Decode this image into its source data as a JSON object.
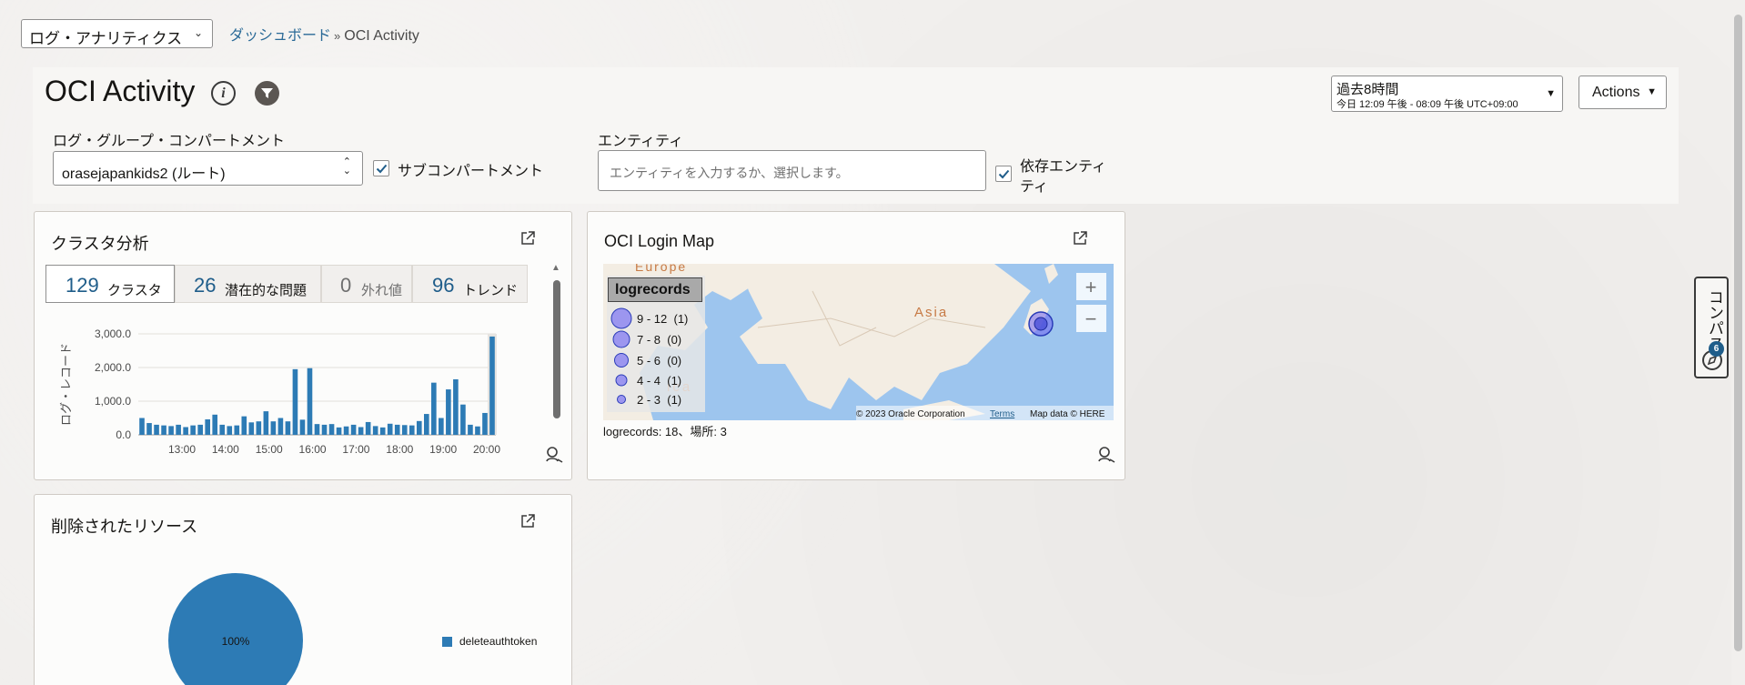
{
  "app_selector": {
    "value": "ログ・アナリティクス"
  },
  "breadcrumb": {
    "parent": "ダッシュボード",
    "separator": "»",
    "current": "OCI Activity"
  },
  "header": {
    "title": "OCI Activity",
    "time_range": {
      "label": "過去8時間",
      "detail": "今日 12:09 午後 - 08:09 午後 UTC+09:00"
    },
    "actions_label": "Actions",
    "compartment_label": "ログ・グループ・コンパートメント",
    "compartment_value": "orasejapankids2 (ルート)",
    "sub_compartment_label": "サブコンパートメント",
    "sub_compartment_checked": true,
    "entity_label": "エンティティ",
    "entity_placeholder": "エンティティを入力するか、選択します。",
    "dependent_entity_label_1": "依存エンティ",
    "dependent_entity_label_2": "ティ",
    "dependent_entity_checked": true
  },
  "cluster_card": {
    "title": "クラスタ分析",
    "tabs": [
      {
        "count": "129",
        "label": "クラスタ",
        "active": true
      },
      {
        "count": "26",
        "label": "潜在的な問題",
        "active": false
      },
      {
        "count": "0",
        "label": "外れ値",
        "active": false
      },
      {
        "count": "96",
        "label": "トレンド",
        "active": false
      }
    ]
  },
  "chart_data": {
    "type": "bar",
    "ylabel": "ログ・レコード",
    "ylim": [
      0,
      3000
    ],
    "y_ticks": [
      "0.0",
      "1,000.0",
      "2,000.0",
      "3,000.0"
    ],
    "x_ticks": [
      "13:00",
      "14:00",
      "15:00",
      "16:00",
      "17:00",
      "18:00",
      "19:00",
      "20:00"
    ],
    "color": "#2d7bb5",
    "values": [
      500,
      350,
      300,
      280,
      260,
      300,
      230,
      280,
      300,
      460,
      600,
      300,
      260,
      280,
      550,
      370,
      400,
      700,
      400,
      500,
      400,
      1950,
      450,
      1980,
      320,
      300,
      320,
      220,
      250,
      300,
      230,
      380,
      260,
      220,
      330,
      300,
      290,
      280,
      410,
      620,
      1550,
      500,
      1350,
      1650,
      900,
      300,
      250,
      650,
      2920
    ]
  },
  "map_card": {
    "title": "OCI Login Map",
    "legend_title": "logrecords",
    "legend": [
      {
        "range": "9 - 12",
        "count": "(1)"
      },
      {
        "range": "7 - 8",
        "count": "(0)"
      },
      {
        "range": "5 - 6",
        "count": "(0)"
      },
      {
        "range": "4 - 4",
        "count": "(1)"
      },
      {
        "range": "2 - 3",
        "count": "(1)"
      }
    ],
    "labels": {
      "europe": "Europe",
      "asia": "Asia",
      "africa": "ica"
    },
    "credit": "© 2023 Oracle Corporation",
    "terms": "Terms",
    "map_data": "Map data © HERE",
    "summary": "logrecords: 18、場所: 3",
    "zoom_in": "+",
    "zoom_out": "−"
  },
  "deleted_card": {
    "title": "削除されたリソース",
    "pie_label": "100%",
    "legend_label": "deleteauthtoken",
    "color": "#2d7bb5"
  },
  "compass": {
    "label": "コンパス",
    "badge": "6"
  }
}
